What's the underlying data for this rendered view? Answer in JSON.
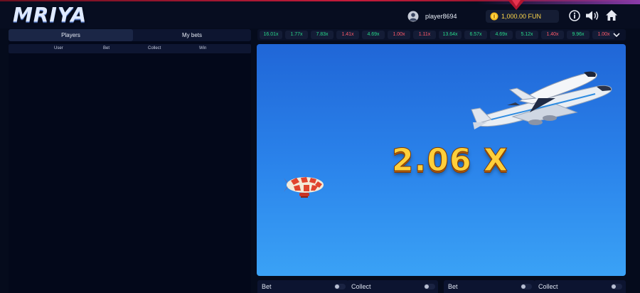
{
  "header": {
    "logo": "MRIYA",
    "username": "player8694",
    "balance": "1,000.00 FUN"
  },
  "left_panel": {
    "tabs": [
      {
        "label": "Players",
        "active": true
      },
      {
        "label": "My bets",
        "active": false
      }
    ],
    "columns": [
      "User",
      "Bet",
      "Collect",
      "Win"
    ]
  },
  "history": [
    {
      "value": "16.01x",
      "color": "#27d98a"
    },
    {
      "value": "1.77x",
      "color": "#27d98a"
    },
    {
      "value": "7.83x",
      "color": "#27d98a"
    },
    {
      "value": "1.41x",
      "color": "#ff5a6a"
    },
    {
      "value": "4.69x",
      "color": "#27d98a"
    },
    {
      "value": "1.00x",
      "color": "#ff5a6a"
    },
    {
      "value": "1.11x",
      "color": "#ff5a6a"
    },
    {
      "value": "13.64x",
      "color": "#27d98a"
    },
    {
      "value": "6.57x",
      "color": "#27d98a"
    },
    {
      "value": "4.69x",
      "color": "#27d98a"
    },
    {
      "value": "5.12x",
      "color": "#27d98a"
    },
    {
      "value": "1.40x",
      "color": "#ff5a6a"
    },
    {
      "value": "9.96x",
      "color": "#27d98a"
    },
    {
      "value": "1.00x",
      "color": "#ff5a6a"
    }
  ],
  "game": {
    "multiplier": "2.06 X"
  },
  "bet_panels": [
    {
      "bet_label": "Bet",
      "collect_label": "Collect"
    },
    {
      "bet_label": "Bet",
      "collect_label": "Collect"
    }
  ],
  "colors": {
    "win": "#27d98a",
    "lose": "#ff5a6a",
    "gold": "#ffd84a"
  }
}
